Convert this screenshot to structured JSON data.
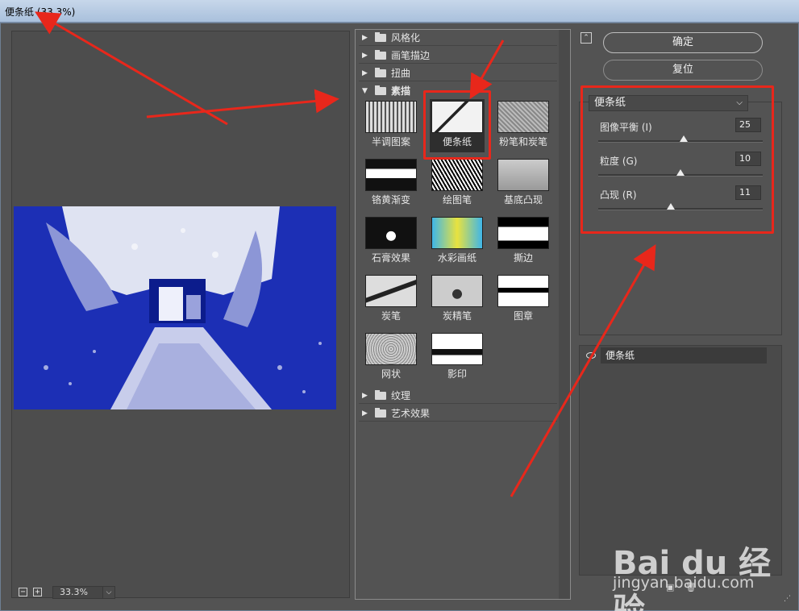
{
  "window": {
    "title": "便条纸 (33.3%)"
  },
  "preview": {
    "zoom_value": "33.3%",
    "zoom_out": "−",
    "zoom_in": "+"
  },
  "gallery": {
    "categories_top": [
      {
        "label": "风格化"
      },
      {
        "label": "画笔描边"
      },
      {
        "label": "扭曲"
      },
      {
        "label": "素描"
      }
    ],
    "thumbnails": [
      {
        "label": "半调图案"
      },
      {
        "label": "便条纸"
      },
      {
        "label": "粉笔和炭笔"
      },
      {
        "label": "铬黄渐变"
      },
      {
        "label": "绘图笔"
      },
      {
        "label": "基底凸现"
      },
      {
        "label": "石膏效果"
      },
      {
        "label": "水彩画纸"
      },
      {
        "label": "撕边"
      },
      {
        "label": "炭笔"
      },
      {
        "label": "炭精笔"
      },
      {
        "label": "图章"
      },
      {
        "label": "网状"
      },
      {
        "label": "影印"
      }
    ],
    "categories_bottom": [
      {
        "label": "纹理"
      },
      {
        "label": "艺术效果"
      }
    ]
  },
  "panel": {
    "ok_label": "确定",
    "reset_label": "复位",
    "filter_selected": "便条纸",
    "params": [
      {
        "label": "图像平衡 (I)",
        "value": "25",
        "fraction": 0.52
      },
      {
        "label": "粒度 (G)",
        "value": "10",
        "fraction": 0.5
      },
      {
        "label": "凸现 (R)",
        "value": "11",
        "fraction": 0.44
      }
    ],
    "layer_name": "便条纸"
  },
  "watermark": {
    "main": "Bai du 经验",
    "sub": "jingyan.baidu.com"
  },
  "colors": {
    "annotation_red": "#e8271b",
    "preview_blue": "#1c2fb5"
  }
}
